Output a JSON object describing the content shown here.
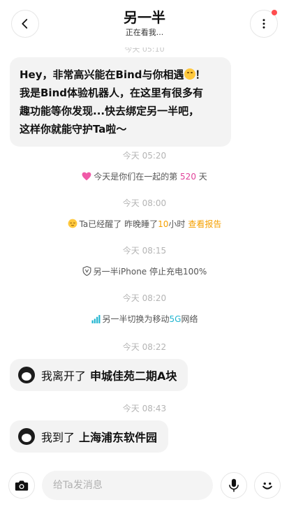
{
  "header": {
    "title": "另一半",
    "subtitle": "正在看我..."
  },
  "messages": {
    "ghost_time": "今天 05:10",
    "intro": {
      "line1_a": "Hey，非常高兴能在Bind与你相遇",
      "line1_b": "！",
      "line2": "我是Bind体验机器人，在这里有很多有",
      "line3": "趣功能等你发现...快去绑定另一半吧，",
      "line4": "这样你就能守护Ta啦～"
    },
    "t1": "今天 05:20",
    "anniv": {
      "prefix": "今天是你们在一起的第 ",
      "days": "520",
      "suffix": " 天"
    },
    "t2": "今天 08:00",
    "sleep": {
      "prefix": "Ta已经醒了 昨晚睡了",
      "hours": "10",
      "suffix": "小时",
      "link": "查看报告"
    },
    "t3": "今天 08:15",
    "charge": "另一半iPhone 停止充电100%",
    "t4": "今天 08:20",
    "network": {
      "prefix": "另一半切换为移动",
      "type": "5G",
      "suffix": "网络"
    },
    "t5": "今天 08:22",
    "leave": {
      "text": "我离开了",
      "place": "申城佳苑二期A块"
    },
    "t6": "今天 08:43",
    "arrive": {
      "text": "我到了",
      "place": "上海浦东软件园"
    }
  },
  "input": {
    "placeholder": "给Ta发消息"
  },
  "icons": {
    "back": "chevron-left-icon",
    "more": "more-vertical-icon",
    "camera": "camera-icon",
    "mic": "microphone-icon",
    "emoji": "smile-icon"
  },
  "colors": {
    "pink": "#e0439a",
    "orange": "#f5a000",
    "cyan": "#20b5d0",
    "badge": "#ff4d4f"
  }
}
